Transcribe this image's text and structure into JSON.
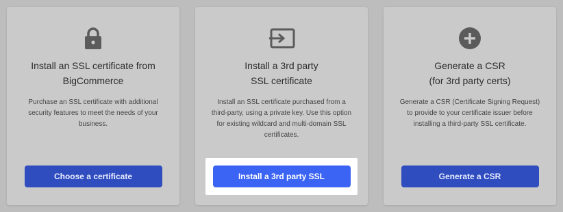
{
  "cards": [
    {
      "icon": "lock-icon",
      "title_line1": "Install an SSL certificate from",
      "title_line2": "BigCommerce",
      "description": "Purchase an SSL certificate with additional security features to meet the needs of your business.",
      "button_label": "Choose a certificate"
    },
    {
      "icon": "import-icon",
      "title_line1": "Install a 3rd party",
      "title_line2": "SSL certificate",
      "description": "Install an SSL certificate purchased from a third-party, using a private key. Use this option for existing wildcard and multi-domain SSL certificates.",
      "button_label": "Install a 3rd party SSL"
    },
    {
      "icon": "plus-circle-icon",
      "title_line1": "Generate a CSR",
      "title_line2": "(for 3rd party certs)",
      "description": "Generate a CSR (Certificate Signing Request) to provide to your certificate issuer before installing a third-party SSL certificate.",
      "button_label": "Generate a CSR"
    }
  ],
  "colors": {
    "overlay_background": "#bdbdbd",
    "card_background": "#cacaca",
    "button_dimmed": "#2f4dbf",
    "button_highlighted": "#3c64f4",
    "highlight_frame": "#ffffff"
  }
}
